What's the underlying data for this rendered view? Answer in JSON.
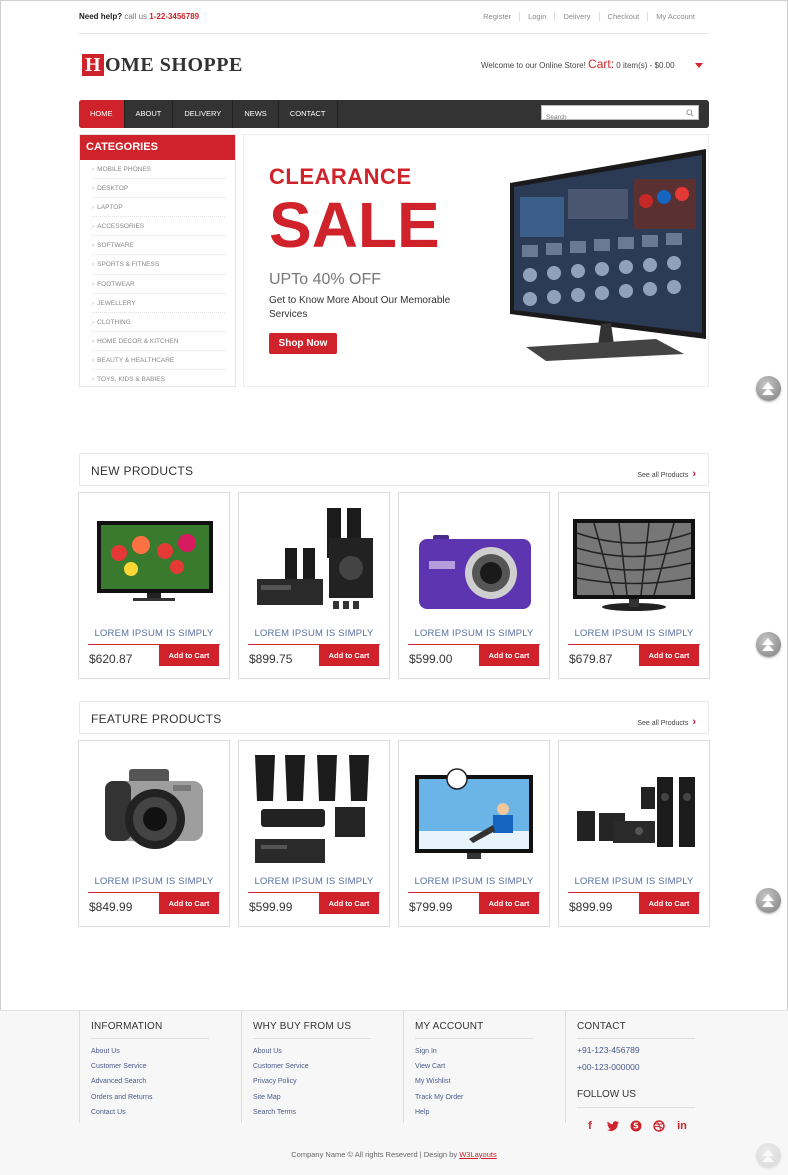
{
  "topbar": {
    "help_label": "Need help?",
    "call_label": "call us",
    "phone": "1-22-3456789",
    "links": [
      "Register",
      "Login",
      "Delivery",
      "Checkout",
      "My Account"
    ]
  },
  "header": {
    "logo_initial": "H",
    "logo_rest": "OME SHOPPE",
    "welcome": "Welcome to our Online Store!",
    "cart_label": "Cart:",
    "cart_summary": "0 item(s) - $0.00"
  },
  "nav": {
    "items": [
      "HOME",
      "ABOUT",
      "DELIVERY",
      "NEWS",
      "CONTACT"
    ],
    "search_placeholder": "Search"
  },
  "categories": {
    "title": "CATEGORIES",
    "items": [
      "MOBILE PHONES",
      "DESKTOP",
      "LAPTOP",
      "ACCESSORIES",
      "SOFTWARE",
      "SPORTS & FITNESS",
      "FOOTWEAR",
      "JEWELLERY",
      "CLOTHING",
      "HOME DECOR & KITCHEN",
      "BEAUTY & HEALTHCARE",
      "TOYS, KIDS & BABIES"
    ]
  },
  "banner": {
    "line1": "CLEARANCE",
    "line2": "SALE",
    "offer": "UPTo 40% OFF",
    "text": "Get to Know More About Our Memorable Services",
    "button": "Shop Now"
  },
  "new_products": {
    "title": "NEW PRODUCTS",
    "see_all": "See all Products",
    "items": [
      {
        "name": "LOREM IPSUM IS SIMPLY",
        "price": "$620.87",
        "button": "Add to Cart",
        "icon": "tv-flowers-icon"
      },
      {
        "name": "LOREM IPSUM IS SIMPLY",
        "price": "$899.75",
        "button": "Add to Cart",
        "icon": "speaker-system-icon"
      },
      {
        "name": "LOREM IPSUM IS SIMPLY",
        "price": "$599.00",
        "button": "Add to Cart",
        "icon": "purple-camera-icon"
      },
      {
        "name": "LOREM IPSUM IS SIMPLY",
        "price": "$679.87",
        "button": "Add to Cart",
        "icon": "tv-dome-icon"
      }
    ]
  },
  "feature_products": {
    "title": "FEATURE PRODUCTS",
    "see_all": "See all Products",
    "items": [
      {
        "name": "LOREM IPSUM IS SIMPLY",
        "price": "$849.99",
        "button": "Add to Cart",
        "icon": "dslr-camera-icon"
      },
      {
        "name": "LOREM IPSUM IS SIMPLY",
        "price": "$599.99",
        "button": "Add to Cart",
        "icon": "home-theater-icon"
      },
      {
        "name": "LOREM IPSUM IS SIMPLY",
        "price": "$799.99",
        "button": "Add to Cart",
        "icon": "tv-football-icon"
      },
      {
        "name": "LOREM IPSUM IS SIMPLY",
        "price": "$899.99",
        "button": "Add to Cart",
        "icon": "speaker-set-icon"
      }
    ]
  },
  "footer": {
    "information": {
      "title": "INFORMATION",
      "links": [
        "About Us",
        "Customer Service",
        "Advanced Search",
        "Orders and Returns",
        "Contact Us"
      ]
    },
    "why_buy": {
      "title": "WHY BUY FROM US",
      "links": [
        "About Us",
        "Customer Service",
        "Privacy Policy",
        "Site Map",
        "Search Terms"
      ]
    },
    "my_account": {
      "title": "MY ACCOUNT",
      "links": [
        "Sign In",
        "View Cart",
        "My Wishlist",
        "Track My Order",
        "Help"
      ]
    },
    "contact": {
      "title": "CONTACT",
      "phones": [
        "+91-123-456789",
        "+00-123-000000"
      ],
      "follow_title": "FOLLOW US"
    },
    "copyright": "Company Name © All rights Reseverd | Design by",
    "designer": "W3Layouts"
  },
  "colors": {
    "accent": "#d0222b",
    "nav_bg": "#333333"
  }
}
